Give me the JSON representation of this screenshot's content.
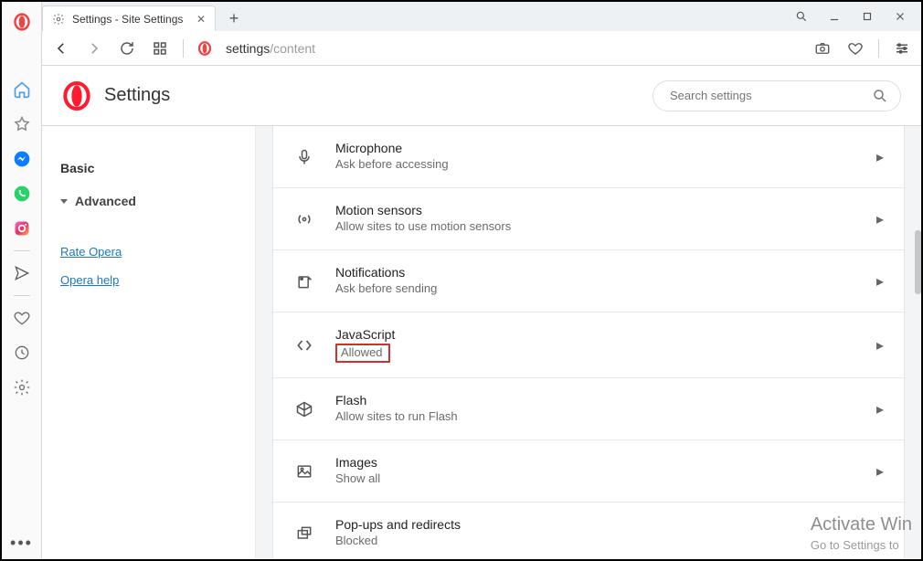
{
  "tab": {
    "title": "Settings - Site Settings"
  },
  "address": {
    "pre": "settings",
    "post": "/content"
  },
  "header": {
    "title": "Settings"
  },
  "search": {
    "placeholder": "Search settings"
  },
  "nav": {
    "basic": "Basic",
    "advanced": "Advanced",
    "rate": "Rate Opera",
    "help": "Opera help"
  },
  "rows": {
    "microphone": {
      "title": "Microphone",
      "sub": "Ask before accessing"
    },
    "motion": {
      "title": "Motion sensors",
      "sub": "Allow sites to use motion sensors"
    },
    "notifications": {
      "title": "Notifications",
      "sub": "Ask before sending"
    },
    "javascript": {
      "title": "JavaScript",
      "sub": "Allowed"
    },
    "flash": {
      "title": "Flash",
      "sub": "Allow sites to run Flash"
    },
    "images": {
      "title": "Images",
      "sub": "Show all"
    },
    "popups": {
      "title": "Pop-ups and redirects",
      "sub": "Blocked"
    }
  },
  "watermark": {
    "line1": "Activate Win",
    "line2": "Go to Settings to"
  }
}
